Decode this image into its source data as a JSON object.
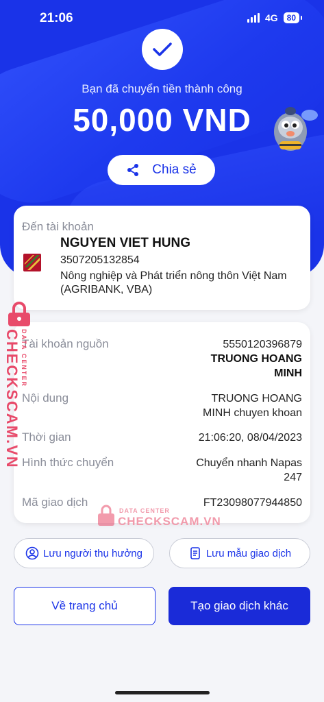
{
  "status_bar": {
    "time": "21:06",
    "network": "4G",
    "battery": "80"
  },
  "header": {
    "success_text": "Bạn đã chuyển tiền thành công",
    "amount": "50,000 VND",
    "share_label": "Chia sẻ"
  },
  "recipient": {
    "to_label": "Đến tài khoản",
    "name": "NGUYEN VIET HUNG",
    "account": "3507205132854",
    "bank": "Nông nghiệp và Phát triển nông thôn Việt Nam (AGRIBANK, VBA)"
  },
  "details": {
    "source_label": "Tài khoản nguồn",
    "source_account": "5550120396879",
    "source_name_line1": "TRUONG HOANG",
    "source_name_line2": "MINH",
    "content_label": "Nội dung",
    "content_line1": "TRUONG HOANG",
    "content_line2": "MINH chuyen khoan",
    "time_label": "Thời gian",
    "time_value": "21:06:20, 08/04/2023",
    "method_label": "Hình thức chuyển",
    "method_line1": "Chuyển nhanh Napas",
    "method_line2": "247",
    "txn_label": "Mã giao dịch",
    "txn_value": "FT23098077944850"
  },
  "actions": {
    "save_beneficiary": "Lưu người thụ hưởng",
    "save_template": "Lưu mẫu giao dịch",
    "home": "Về trang chủ",
    "new_transaction": "Tạo giao dịch khác"
  },
  "watermark": {
    "vertical_big": "CHECKSCAM.VN",
    "vertical_small": "DATA CENTER",
    "center_small": "DATA CENTER",
    "center_big": "CHECKSCAM.VN"
  },
  "colors": {
    "primary": "#1a33e8",
    "watermark": "#e84a6a"
  }
}
